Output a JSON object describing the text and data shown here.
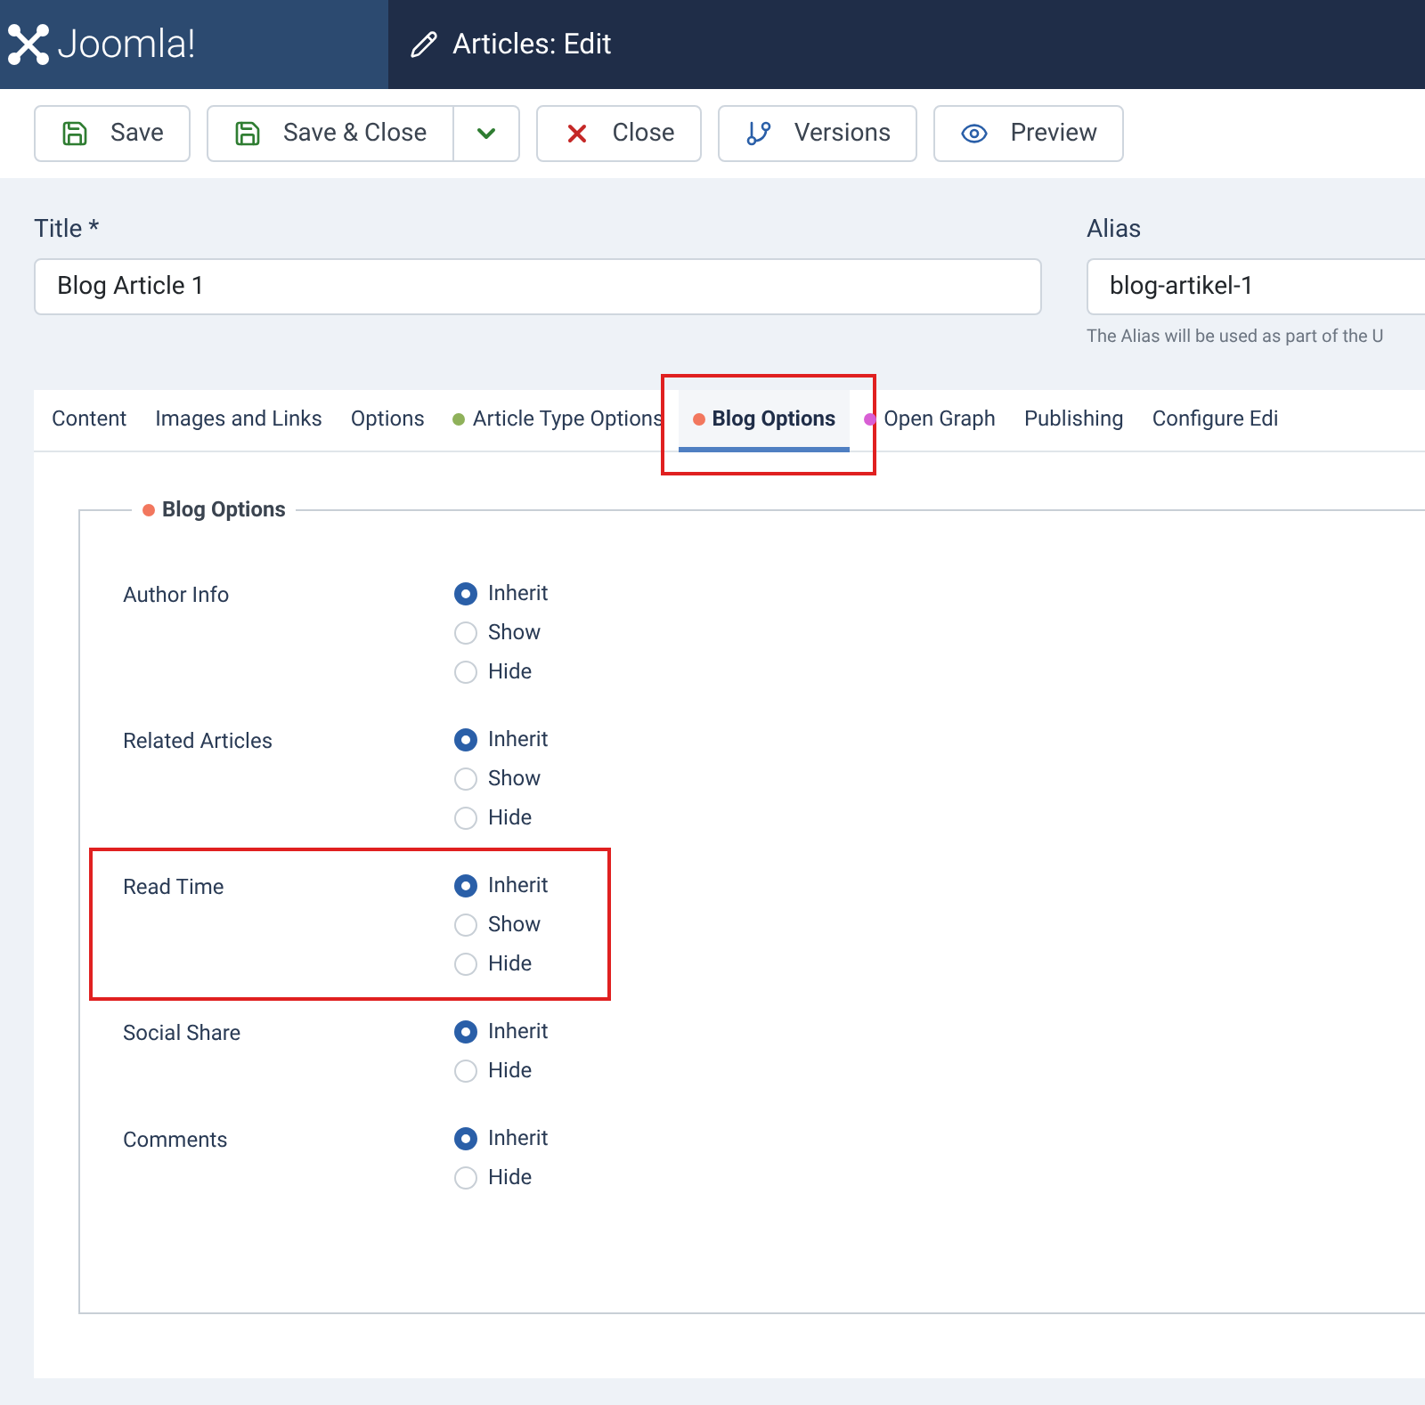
{
  "header": {
    "logo": "Joomla!",
    "title": "Articles: Edit"
  },
  "toolbar": [
    {
      "label": "Save",
      "kind": "save",
      "dropdown": false
    },
    {
      "label": "Save & Close",
      "kind": "save",
      "dropdown": true
    },
    {
      "label": "Close",
      "kind": "close",
      "dropdown": false
    },
    {
      "label": "Versions",
      "kind": "branch",
      "dropdown": false
    },
    {
      "label": "Preview",
      "kind": "eye",
      "dropdown": false
    }
  ],
  "title_field": {
    "label": "Title *",
    "value": "Blog Article 1"
  },
  "alias_field": {
    "label": "Alias",
    "value": "blog-artikel-1",
    "hint": "The Alias will be used as part of the U"
  },
  "tabs": [
    {
      "label": "Content",
      "selected": false,
      "highlighted": false
    },
    {
      "label": "Images and Links",
      "selected": false,
      "highlighted": false
    },
    {
      "label": "Options",
      "selected": false,
      "highlighted": false
    },
    {
      "label": "Article Type Options",
      "selected": false,
      "color": "#8fb15a",
      "highlighted": false
    },
    {
      "label": "Blog Options",
      "selected": true,
      "color": "#f2775e",
      "highlighted": true
    },
    {
      "label": "Open Graph",
      "selected": false,
      "color": "#d85fd4",
      "highlighted": false
    },
    {
      "label": "Publishing",
      "selected": false,
      "highlighted": false
    },
    {
      "label": "Configure Edi",
      "selected": false,
      "highlighted": false
    }
  ],
  "fieldset": {
    "legend": "Blog Options",
    "color": "#f2775e",
    "fields": [
      {
        "label": "Author Info",
        "highlighted": false,
        "options": [
          {
            "label": "Inherit",
            "selected": true
          },
          {
            "label": "Show",
            "selected": false
          },
          {
            "label": "Hide",
            "selected": false
          }
        ]
      },
      {
        "label": "Related Articles",
        "highlighted": false,
        "options": [
          {
            "label": "Inherit",
            "selected": true
          },
          {
            "label": "Show",
            "selected": false
          },
          {
            "label": "Hide",
            "selected": false
          }
        ]
      },
      {
        "label": "Read Time",
        "highlighted": true,
        "options": [
          {
            "label": "Inherit",
            "selected": true
          },
          {
            "label": "Show",
            "selected": false
          },
          {
            "label": "Hide",
            "selected": false
          }
        ]
      },
      {
        "label": "Social Share",
        "highlighted": false,
        "options": [
          {
            "label": "Inherit",
            "selected": true
          },
          {
            "label": "Hide",
            "selected": false
          }
        ]
      },
      {
        "label": "Comments",
        "highlighted": false,
        "options": [
          {
            "label": "Inherit",
            "selected": true
          },
          {
            "label": "Hide",
            "selected": false
          }
        ]
      }
    ]
  }
}
